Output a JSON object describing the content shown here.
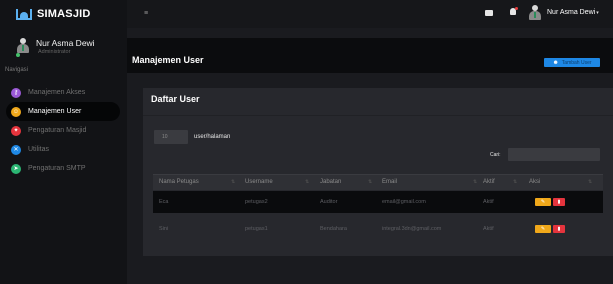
{
  "app": {
    "name": "SIMASJID"
  },
  "user": {
    "name": "Nur Asma Dewi",
    "role": "Administrator"
  },
  "sidebar": {
    "header": "Navigasi",
    "items": [
      {
        "label": "Manajemen Akses",
        "icon": "key-icon",
        "color": "#9b59d6",
        "glyph": "⚷",
        "active": false
      },
      {
        "label": "Manajemen User",
        "icon": "users-icon",
        "color": "#f0a81a",
        "glyph": "☺",
        "active": true
      },
      {
        "label": "Pengaturan Masjid",
        "icon": "cogs-icon",
        "color": "#e5343d",
        "glyph": "✦",
        "active": false
      },
      {
        "label": "Utilitas",
        "icon": "tools-icon",
        "color": "#1e88e5",
        "glyph": "✕",
        "active": false
      },
      {
        "label": "Pengaturan SMTP",
        "icon": "send-icon",
        "color": "#2bb673",
        "glyph": "➤",
        "active": false
      }
    ]
  },
  "topbar": {
    "menu_glyph": "≡",
    "user_name": "Nur Asma Dewi"
  },
  "page": {
    "title": "Manajemen User",
    "add_button": "Tambah User"
  },
  "card": {
    "title": "Daftar User",
    "length_value": "10",
    "length_label": "user/halaman",
    "search_label": "Cari:",
    "search_value": ""
  },
  "table": {
    "columns": [
      "Nama Petugas",
      "Username",
      "Jabatan",
      "Email",
      "Aktif",
      "Aksi"
    ],
    "rows": [
      {
        "nama": "Eca",
        "username": "petugas2",
        "jabatan": "Auditor",
        "email": "email@gmail.com",
        "aktif": "Aktif"
      },
      {
        "nama": "Sini",
        "username": "petugas1",
        "jabatan": "Bendahara",
        "email": "integral.3dn@gmail.com",
        "aktif": "Aktif"
      }
    ]
  },
  "colors": {
    "accent": "#1e88e5",
    "edit": "#f0a81a",
    "delete": "#e5343d"
  }
}
